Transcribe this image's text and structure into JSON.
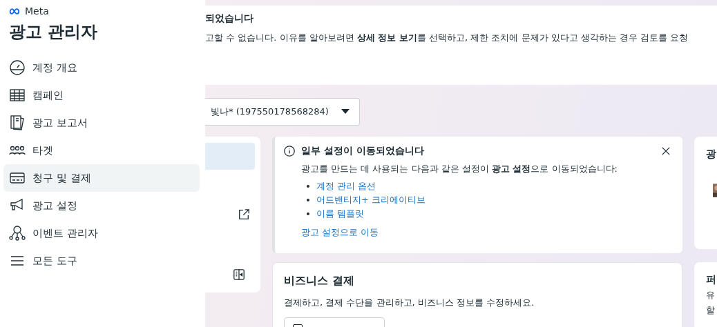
{
  "sidebar": {
    "brand": "Meta",
    "title": "광고 관리자",
    "items": [
      {
        "label": "계정 개요",
        "selected": false
      },
      {
        "label": "캠페인",
        "selected": false
      },
      {
        "label": "광고 보고서",
        "selected": false
      },
      {
        "label": "타겟",
        "selected": false
      },
      {
        "label": "청구 및 결제",
        "selected": true
      },
      {
        "label": "광고 설정",
        "selected": false
      },
      {
        "label": "이벤트 관리자",
        "selected": false
      },
      {
        "label": "모든 도구",
        "selected": false
      }
    ]
  },
  "banner": {
    "title": "되었습니다",
    "body": "고할 수 없습니다. 이유를 알아보려면 **상세 정보 보기**를 선택하고, 제한 조치에 문제가 있다고 생각하는 경우 검토를 요청"
  },
  "account_dropdown": {
    "value": "빛나* (197550178568284)"
  },
  "notice": {
    "title": "일부 설정이 이동되었습니다",
    "body": "광고를 만드는 데 사용되는 다음과 같은 설정이 **광고 설정**으로 이동되었습니다:",
    "links": [
      "계정 관리 옵션",
      "어드밴티지+ 크리에이티브",
      "이름 템플릿"
    ],
    "action": "광고 설정으로 이동"
  },
  "business_payment": {
    "title": "비즈니스 결제",
    "body": "결제하고, 결제 수단을 관리하고, 비즈니스 정보를 수정하세요."
  },
  "right_cards": [
    {
      "title": "광"
    },
    {
      "title": "퍼",
      "lines": [
        "유",
        "할"
      ]
    }
  ]
}
